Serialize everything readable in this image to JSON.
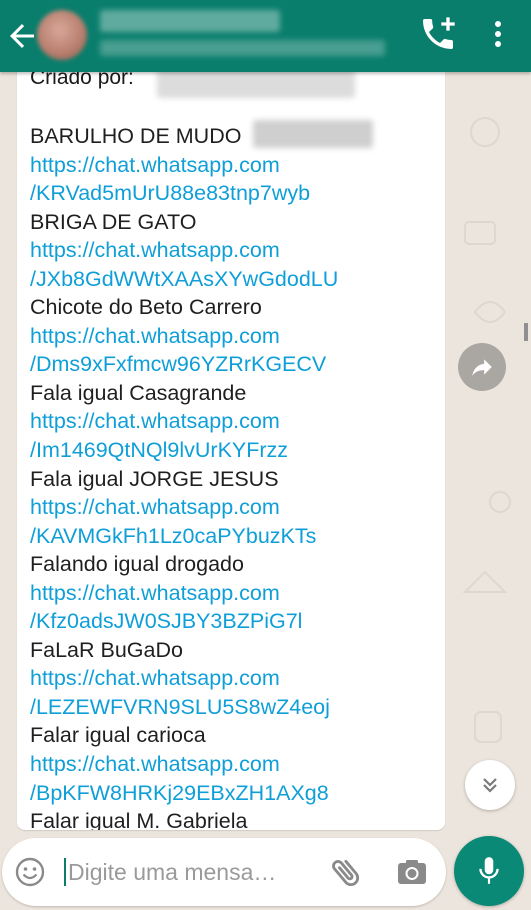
{
  "colors": {
    "header_bg": "#0a7e6c",
    "link": "#0f9fd8",
    "chat_bg": "#ece5dd",
    "mic_bg": "#0a8a76"
  },
  "header": {
    "back_icon": "arrow-left-icon",
    "call_icon": "add-call-icon",
    "menu_icon": "more-vert-icon"
  },
  "message": {
    "created_by_label": "Criado por:",
    "entries": [
      {
        "title": "BARULHO DE MUDO",
        "url_host": "https://chat.whatsapp.com",
        "url_path": "/KRVad5mUrU88e83tnp7wyb"
      },
      {
        "title": "BRIGA DE GATO",
        "url_host": "https://chat.whatsapp.com",
        "url_path": "/JXb8GdWWtXAAsXYwGdodLU"
      },
      {
        "title": "Chicote do Beto Carrero",
        "url_host": "https://chat.whatsapp.com",
        "url_path": "/Dms9xFxfmcw96YZRrKGECV"
      },
      {
        "title": "Fala igual Casagrande",
        "url_host": "https://chat.whatsapp.com",
        "url_path": "/Im1469QtNQl9lvUrKYFrzz"
      },
      {
        "title": "Fala igual JORGE JESUS",
        "url_host": "https://chat.whatsapp.com",
        "url_path": "/KAVMGkFh1Lz0caPYbuzKTs"
      },
      {
        "title": "Falando igual drogado",
        "url_host": "https://chat.whatsapp.com",
        "url_path": "/Kfz0adsJW0SJBY3BZPiG7l"
      },
      {
        "title": "FaLaR BuGaDo",
        "url_host": "https://chat.whatsapp.com",
        "url_path": "/LEZEWFVRN9SLU5S8wZ4eoj"
      },
      {
        "title": "Falar igual carioca",
        "url_host": "https://chat.whatsapp.com",
        "url_path": "/BpKFW8HRKj29EBxZH1AXg8"
      },
      {
        "title": "Falar igual M. Gabriela",
        "url_host": "",
        "url_path": ""
      }
    ]
  },
  "input": {
    "placeholder": "Digite uma mensa…",
    "emoji_icon": "emoji-icon",
    "attach_icon": "paperclip-icon",
    "camera_icon": "camera-icon",
    "mic_icon": "mic-icon"
  }
}
